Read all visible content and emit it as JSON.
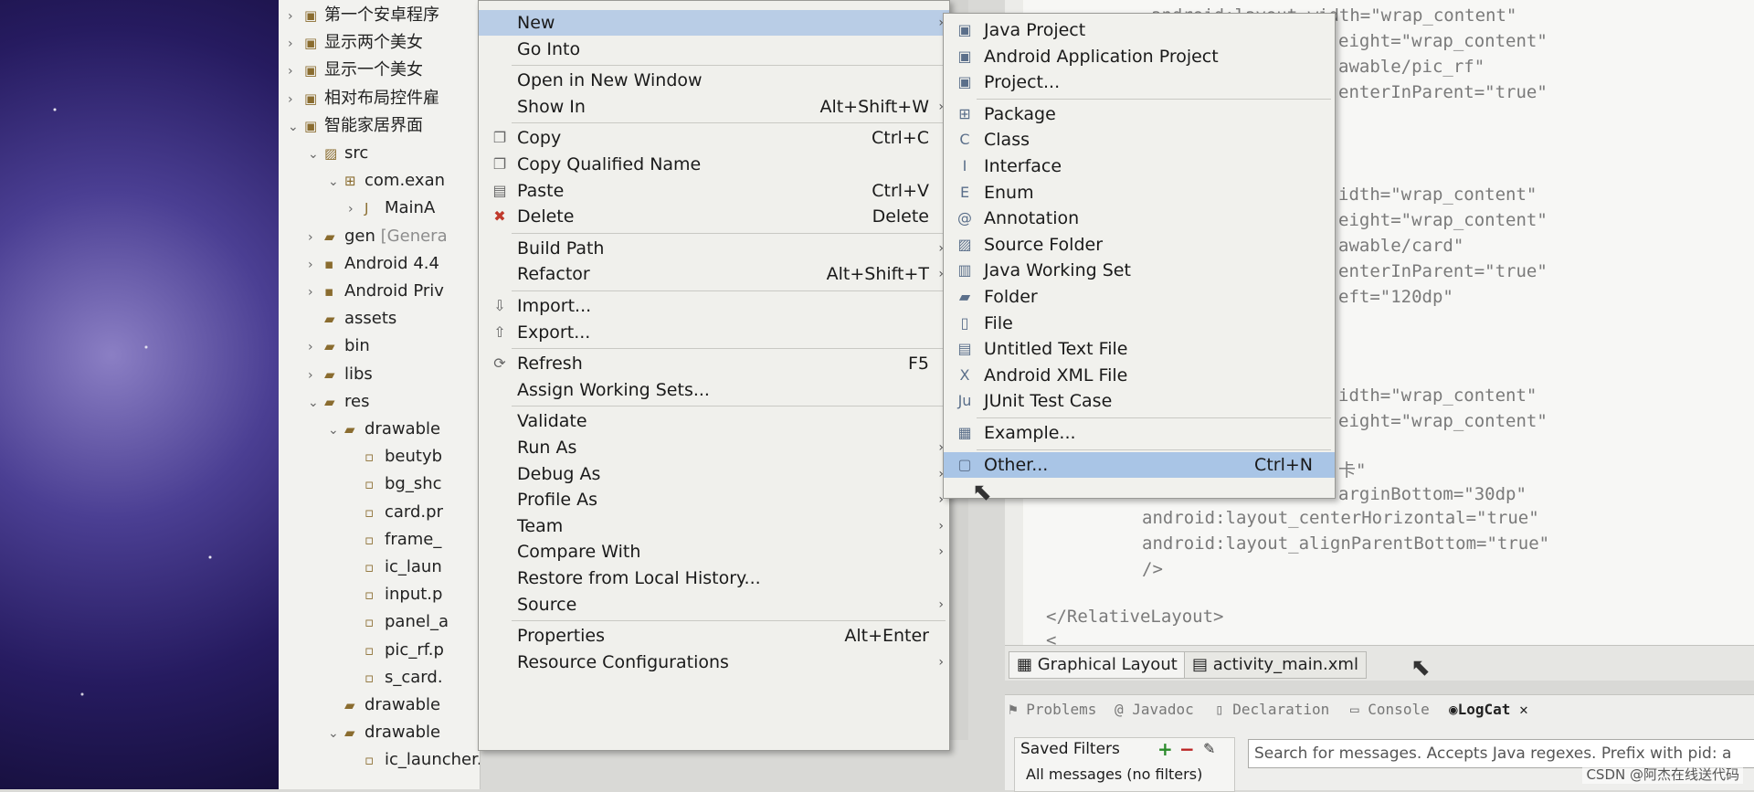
{
  "project_tree": [
    {
      "label": "第一个安卓程序",
      "level": 0,
      "twisty": "›",
      "icon": "project-icon"
    },
    {
      "label": "显示两个美女",
      "level": 0,
      "twisty": "›",
      "icon": "project-icon"
    },
    {
      "label": "显示一个美女",
      "level": 0,
      "twisty": "›",
      "icon": "project-icon"
    },
    {
      "label": "相对布局控件雇",
      "level": 0,
      "twisty": "›",
      "icon": "project-icon"
    },
    {
      "label": "智能家居界面",
      "level": 0,
      "twisty": "⌄",
      "icon": "project-icon"
    },
    {
      "label": "src",
      "level": 1,
      "twisty": "⌄",
      "icon": "source-folder-icon"
    },
    {
      "label": "com.exan",
      "level": 2,
      "twisty": "⌄",
      "icon": "package-icon"
    },
    {
      "label": "MainA",
      "level": 3,
      "twisty": "›",
      "icon": "java-file-icon"
    },
    {
      "label": "gen",
      "suffix": "[Genera",
      "level": 1,
      "twisty": "›",
      "icon": "folder-icon"
    },
    {
      "label": "Android 4.4",
      "level": 1,
      "twisty": "›",
      "icon": "library-icon"
    },
    {
      "label": "Android Priv",
      "level": 1,
      "twisty": "›",
      "icon": "library-icon"
    },
    {
      "label": "assets",
      "level": 1,
      "twisty": "",
      "icon": "folder-icon"
    },
    {
      "label": "bin",
      "level": 1,
      "twisty": "›",
      "icon": "folder-icon"
    },
    {
      "label": "libs",
      "level": 1,
      "twisty": "›",
      "icon": "folder-icon"
    },
    {
      "label": "res",
      "level": 1,
      "twisty": "⌄",
      "icon": "folder-icon"
    },
    {
      "label": "drawable",
      "level": 2,
      "twisty": "⌄",
      "icon": "folder-icon"
    },
    {
      "label": "beutyb",
      "level": 3,
      "twisty": "",
      "icon": "image-file-icon"
    },
    {
      "label": "bg_shc",
      "level": 3,
      "twisty": "",
      "icon": "image-file-icon"
    },
    {
      "label": "card.pr",
      "level": 3,
      "twisty": "",
      "icon": "image-file-icon"
    },
    {
      "label": "frame_",
      "level": 3,
      "twisty": "",
      "icon": "image-file-icon"
    },
    {
      "label": "ic_laun",
      "level": 3,
      "twisty": "",
      "icon": "image-file-icon"
    },
    {
      "label": "input.p",
      "level": 3,
      "twisty": "",
      "icon": "image-file-icon"
    },
    {
      "label": "panel_a",
      "level": 3,
      "twisty": "",
      "icon": "image-file-icon"
    },
    {
      "label": "pic_rf.p",
      "level": 3,
      "twisty": "",
      "icon": "image-file-icon"
    },
    {
      "label": "s_card.",
      "level": 3,
      "twisty": "",
      "icon": "image-file-icon"
    },
    {
      "label": "drawable",
      "level": 2,
      "twisty": "",
      "icon": "folder-icon"
    },
    {
      "label": "drawable",
      "level": 2,
      "twisty": "⌄",
      "icon": "folder-icon"
    },
    {
      "label": "ic_launcher.png",
      "level": 3,
      "twisty": "",
      "icon": "image-file-icon"
    }
  ],
  "context_menu": [
    {
      "label": "New",
      "shortcut": "",
      "submenu": true,
      "highlighted": true,
      "icon": ""
    },
    {
      "label": "Go Into",
      "shortcut": "",
      "submenu": false,
      "icon": ""
    },
    {
      "sep": true
    },
    {
      "label": "Open in New Window",
      "shortcut": "",
      "submenu": false,
      "icon": ""
    },
    {
      "label": "Show In",
      "shortcut": "Alt+Shift+W",
      "submenu": true,
      "icon": ""
    },
    {
      "sep": true
    },
    {
      "label": "Copy",
      "shortcut": "Ctrl+C",
      "submenu": false,
      "icon": "copy-icon"
    },
    {
      "label": "Copy Qualified Name",
      "shortcut": "",
      "submenu": false,
      "icon": "copy-icon"
    },
    {
      "label": "Paste",
      "shortcut": "Ctrl+V",
      "submenu": false,
      "icon": "paste-icon"
    },
    {
      "label": "Delete",
      "shortcut": "Delete",
      "submenu": false,
      "icon": "delete-icon"
    },
    {
      "sep": true
    },
    {
      "label": "Build Path",
      "shortcut": "",
      "submenu": true,
      "icon": ""
    },
    {
      "label": "Refactor",
      "shortcut": "Alt+Shift+T",
      "submenu": true,
      "icon": ""
    },
    {
      "sep": true
    },
    {
      "label": "Import...",
      "shortcut": "",
      "submenu": false,
      "icon": "import-icon"
    },
    {
      "label": "Export...",
      "shortcut": "",
      "submenu": false,
      "icon": "export-icon"
    },
    {
      "sep": true
    },
    {
      "label": "Refresh",
      "shortcut": "F5",
      "submenu": false,
      "icon": "refresh-icon"
    },
    {
      "label": "Assign Working Sets...",
      "shortcut": "",
      "submenu": false,
      "icon": ""
    },
    {
      "sep": true
    },
    {
      "label": "Validate",
      "shortcut": "",
      "submenu": false,
      "icon": ""
    },
    {
      "label": "Run As",
      "shortcut": "",
      "submenu": true,
      "icon": ""
    },
    {
      "label": "Debug As",
      "shortcut": "",
      "submenu": true,
      "icon": ""
    },
    {
      "label": "Profile As",
      "shortcut": "",
      "submenu": true,
      "icon": ""
    },
    {
      "label": "Team",
      "shortcut": "",
      "submenu": true,
      "icon": ""
    },
    {
      "label": "Compare With",
      "shortcut": "",
      "submenu": true,
      "icon": ""
    },
    {
      "label": "Restore from Local History...",
      "shortcut": "",
      "submenu": false,
      "icon": ""
    },
    {
      "label": "Source",
      "shortcut": "",
      "submenu": true,
      "icon": ""
    },
    {
      "sep": true
    },
    {
      "label": "Properties",
      "shortcut": "Alt+Enter",
      "submenu": false,
      "icon": ""
    },
    {
      "label": "Resource Configurations",
      "shortcut": "",
      "submenu": true,
      "icon": ""
    }
  ],
  "new_submenu": [
    {
      "label": "Java Project",
      "icon": "java-project-icon"
    },
    {
      "label": "Android Application Project",
      "icon": "android-project-icon"
    },
    {
      "label": "Project...",
      "icon": "project-icon"
    },
    {
      "sep": true
    },
    {
      "label": "Package",
      "icon": "package-icon"
    },
    {
      "label": "Class",
      "icon": "class-icon"
    },
    {
      "label": "Interface",
      "icon": "interface-icon"
    },
    {
      "label": "Enum",
      "icon": "enum-icon"
    },
    {
      "label": "Annotation",
      "icon": "annotation-icon"
    },
    {
      "label": "Source Folder",
      "icon": "source-folder-icon"
    },
    {
      "label": "Java Working Set",
      "icon": "working-set-icon"
    },
    {
      "label": "Folder",
      "icon": "folder-icon"
    },
    {
      "label": "File",
      "icon": "file-icon"
    },
    {
      "label": "Untitled Text File",
      "icon": "text-file-icon"
    },
    {
      "label": "Android XML File",
      "icon": "xml-file-icon"
    },
    {
      "label": "JUnit Test Case",
      "icon": "junit-icon"
    },
    {
      "sep": true
    },
    {
      "label": "Example...",
      "icon": "example-icon"
    },
    {
      "sep": true
    },
    {
      "label": "Other...",
      "shortcut": "Ctrl+N",
      "icon": "other-icon",
      "highlighted": true
    }
  ],
  "code_lines": [
    {
      "t": "android:layout_width=\"wrap_content\""
    },
    {
      "t": "eight=\"wrap_content\""
    },
    {
      "t": "awable/pic_rf\""
    },
    {
      "t": "enterInParent=\"true\""
    },
    {
      "t": "idth=\"wrap_content\""
    },
    {
      "t": "eight=\"wrap_content\""
    },
    {
      "t": "awable/card\""
    },
    {
      "t": "enterInParent=\"true\""
    },
    {
      "t": "eft=\"120dp\""
    },
    {
      "t": "idth=\"wrap_content\""
    },
    {
      "t": "eight=\"wrap_content\""
    },
    {
      "t": "卡\""
    },
    {
      "t": "arginBottom=\"30dp\""
    },
    {
      "t": "android:layout_centerHorizontal=\"true\""
    },
    {
      "t": "android:layout_alignParentBottom=\"true\""
    },
    {
      "t": "/>"
    },
    {
      "t": "</RelativeLayout>"
    },
    {
      "t": "<"
    }
  ],
  "editor_tabs": [
    "Graphical Layout",
    "activity_main.xml"
  ],
  "view_tabs": [
    "Problems",
    "Javadoc",
    "Declaration",
    "Console",
    "LogCat"
  ],
  "saved_filters": {
    "title": "Saved Filters",
    "item": "All messages (no filters)"
  },
  "search_placeholder": "Search for messages. Accepts Java regexes. Prefix with pid: a",
  "watermark": "CSDN @阿杰在线送代码"
}
